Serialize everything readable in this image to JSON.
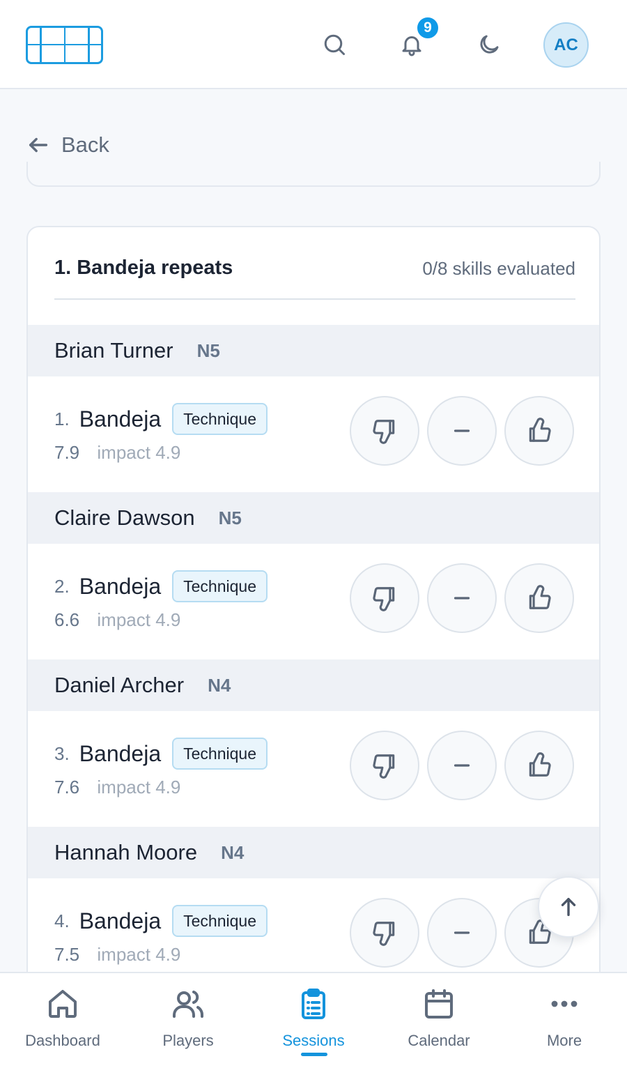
{
  "header": {
    "notifications_count": "9",
    "avatar_initials": "AC",
    "icons": [
      "search-icon",
      "bell-icon",
      "moon-icon"
    ]
  },
  "back_label": "Back",
  "session_block": {
    "title": "1. Bandeja repeats",
    "progress": "0/8 skills evaluated",
    "players": [
      {
        "name": "Brian Turner",
        "level": "N5",
        "skill_num": "1.",
        "skill": "Bandeja",
        "tag": "Technique",
        "score": "7.9",
        "impact": "impact 4.9"
      },
      {
        "name": "Claire Dawson",
        "level": "N5",
        "skill_num": "2.",
        "skill": "Bandeja",
        "tag": "Technique",
        "score": "6.6",
        "impact": "impact 4.9"
      },
      {
        "name": "Daniel Archer",
        "level": "N4",
        "skill_num": "3.",
        "skill": "Bandeja",
        "tag": "Technique",
        "score": "7.6",
        "impact": "impact 4.9"
      },
      {
        "name": "Hannah Moore",
        "level": "N4",
        "skill_num": "4.",
        "skill": "Bandeja",
        "tag": "Technique",
        "score": "7.5",
        "impact": "impact 4.9"
      }
    ]
  },
  "bottom_nav": {
    "active": "Sessions",
    "items": [
      {
        "label": "Dashboard",
        "icon": "home-icon"
      },
      {
        "label": "Players",
        "icon": "users-icon"
      },
      {
        "label": "Sessions",
        "icon": "clipboard-icon"
      },
      {
        "label": "Calendar",
        "icon": "calendar-icon"
      },
      {
        "label": "More",
        "icon": "more-icon"
      }
    ]
  },
  "colors": {
    "accent": "#1493dc",
    "badge": "#0f9ae8"
  }
}
